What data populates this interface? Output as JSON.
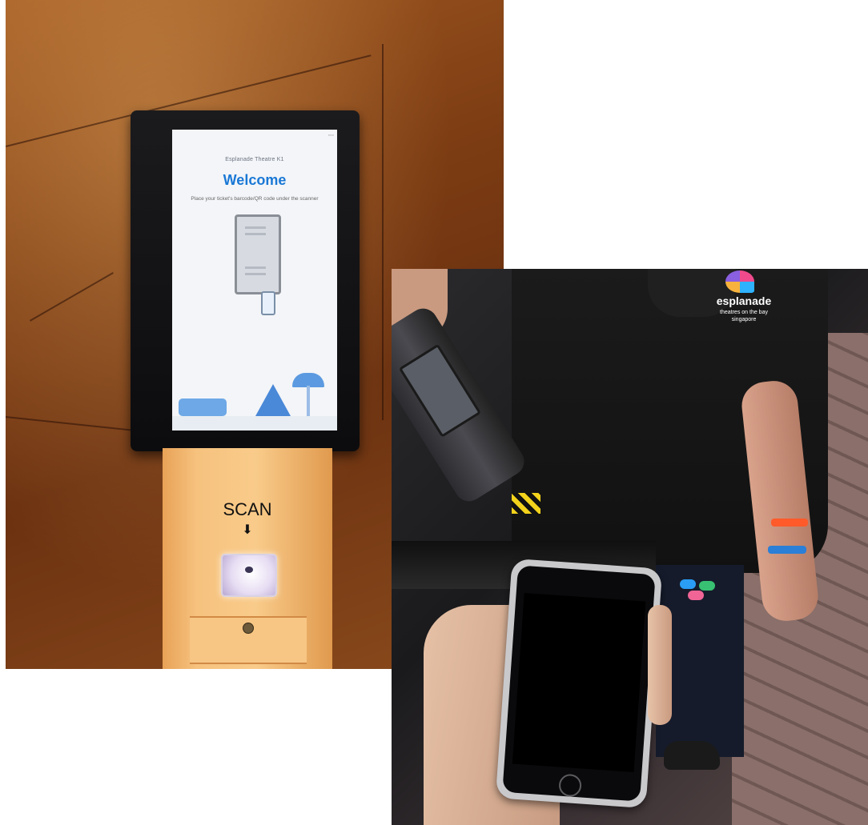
{
  "kiosk_photo": {
    "screen": {
      "venue": "Esplanade Theatre K1",
      "title": "Welcome",
      "instruction": "Place your ticket's barcode/QR code under the scanner"
    },
    "stand_label": "SCAN",
    "arrow_icon": "arrow-down",
    "colors": {
      "welcome_text": "#1a78d6",
      "stand": "#f6c27e",
      "wall": "#7e3d13"
    }
  },
  "scanner_photo": {
    "logo": {
      "name": "esplanade",
      "tagline": "theatres on the bay singapore"
    },
    "colors": {
      "shirt": "#111111",
      "logo_accents": [
        "#f04a8c",
        "#2fb3ff",
        "#f6b23c",
        "#8a5fe0"
      ]
    }
  }
}
